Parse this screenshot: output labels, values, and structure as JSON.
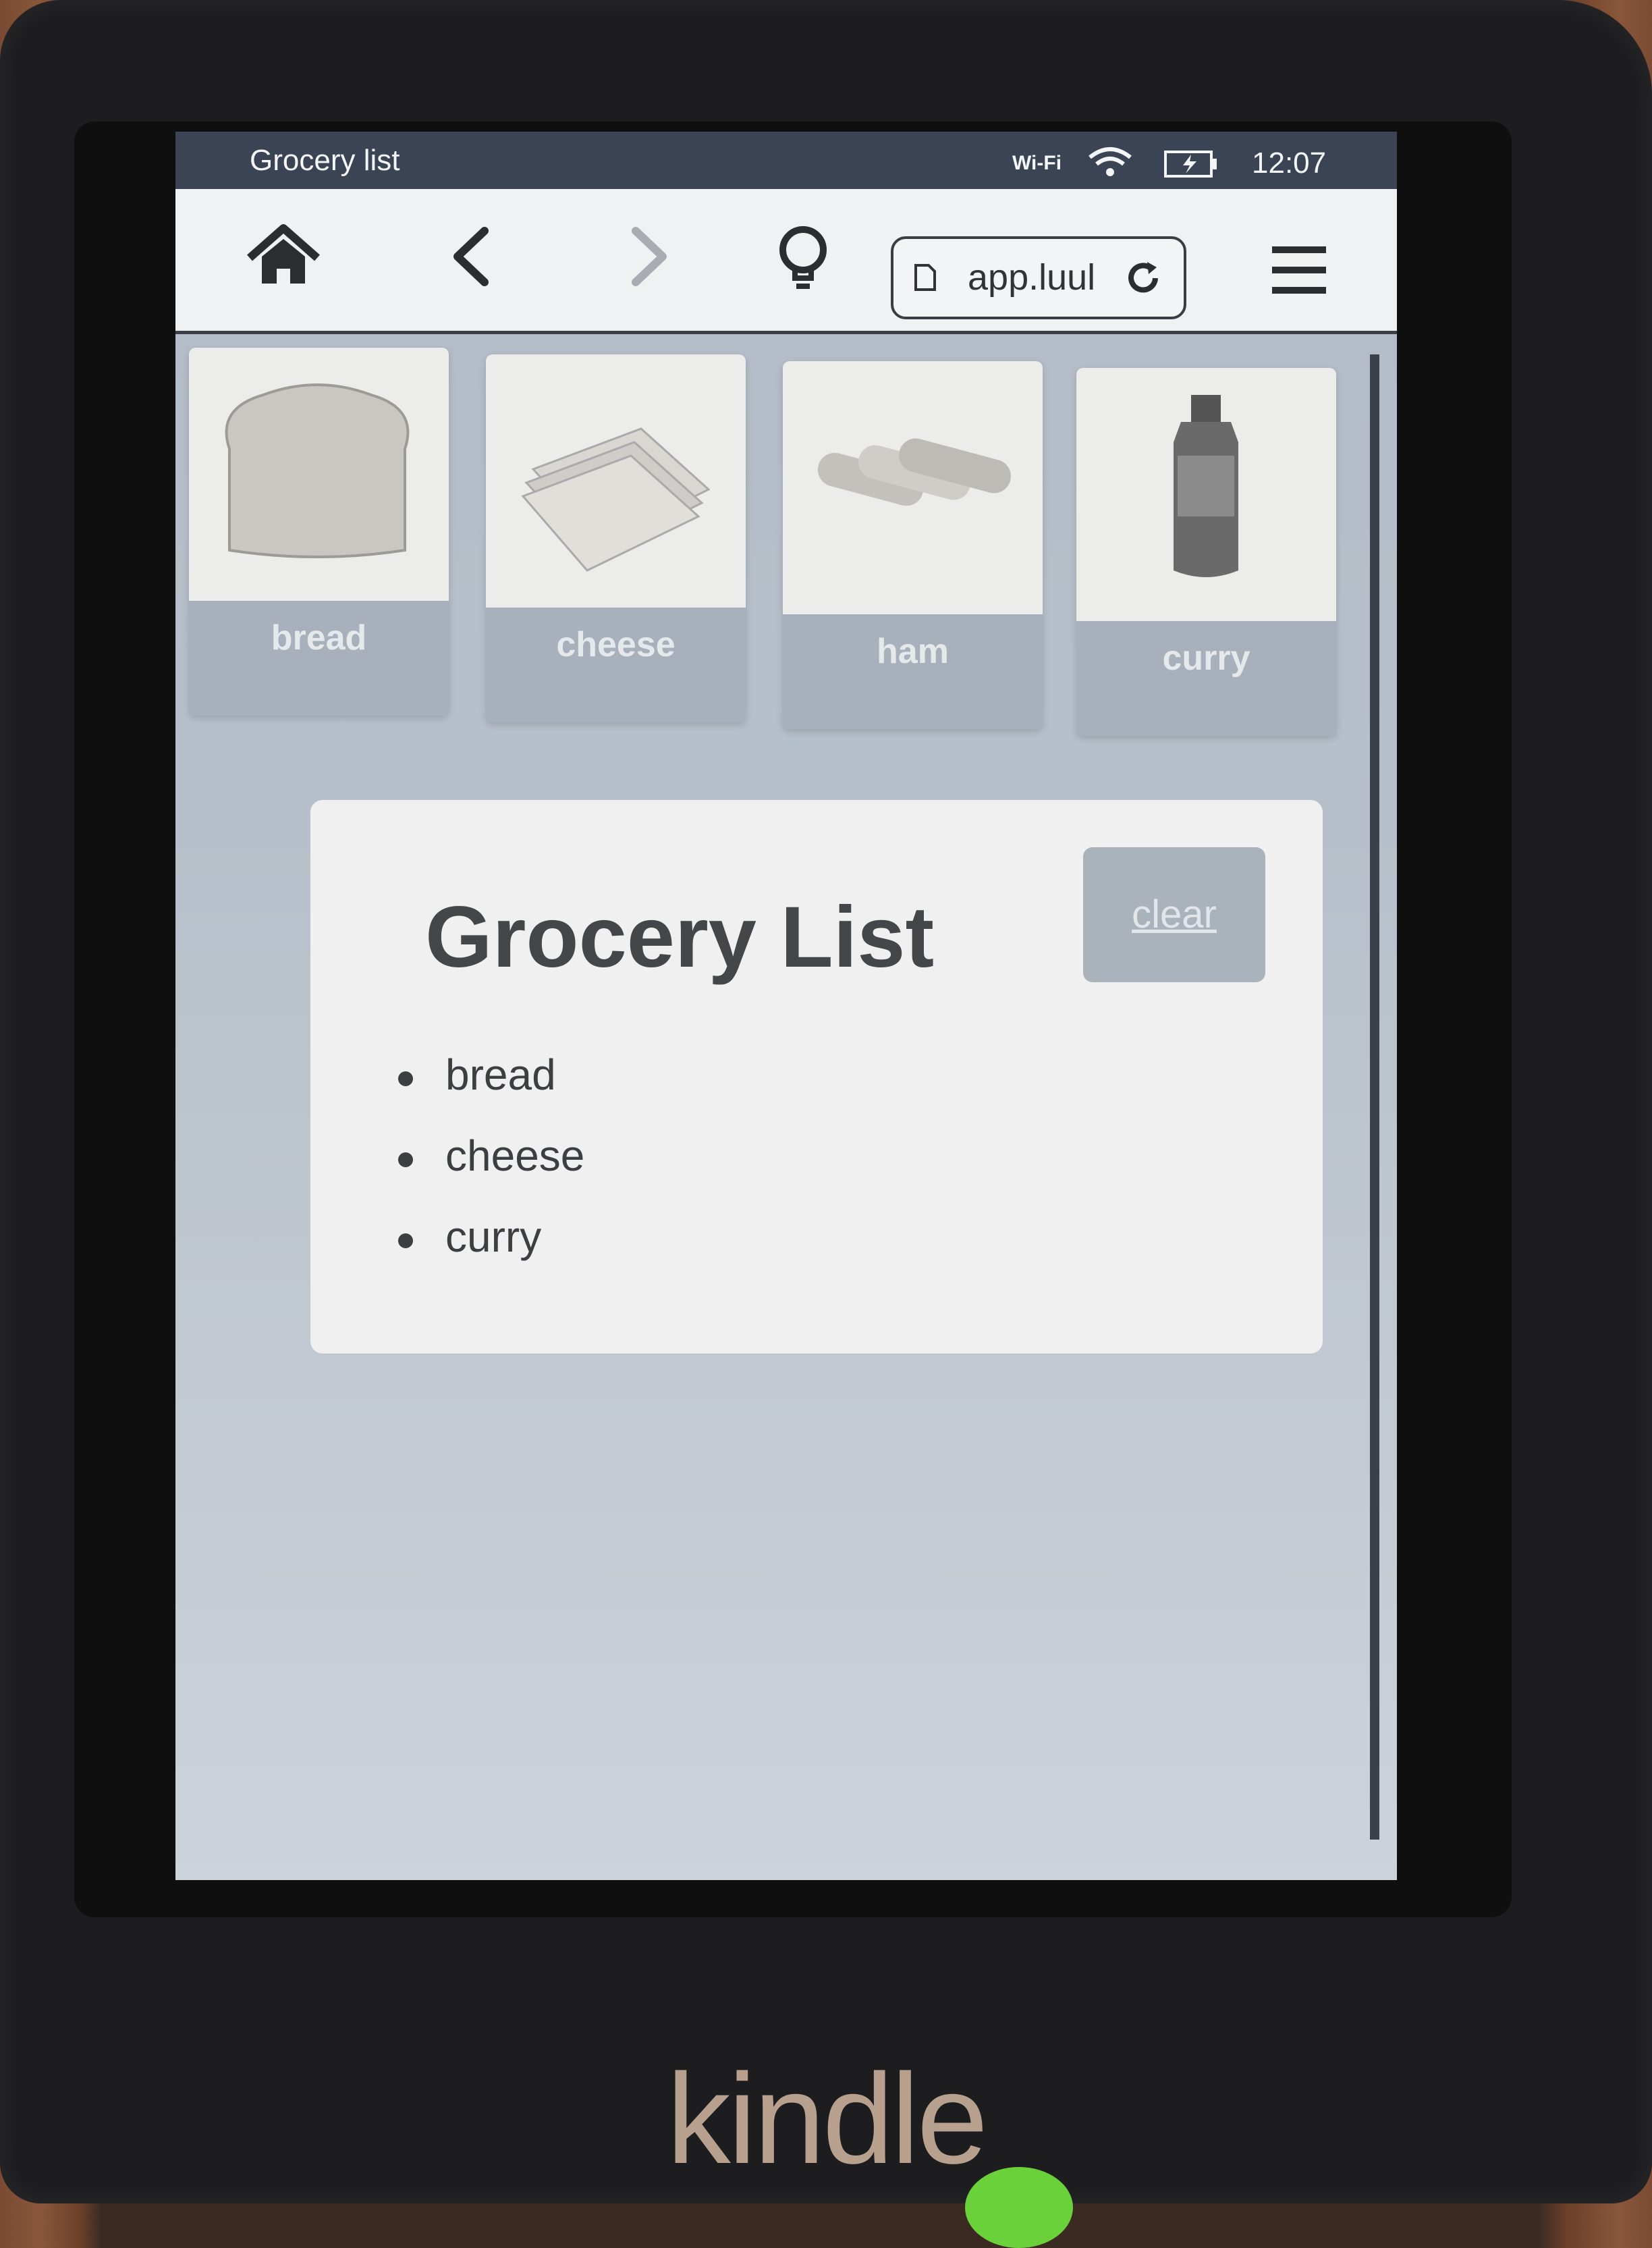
{
  "statusbar": {
    "title": "Grocery list",
    "wifi_label": "Wi-Fi",
    "clock": "12:07"
  },
  "toolbar": {
    "url": "app.luul",
    "icons": [
      "home-icon",
      "back-icon",
      "forward-icon",
      "lightbulb-icon",
      "document-icon",
      "reload-icon",
      "menu-icon"
    ]
  },
  "tiles": [
    {
      "label": "bread"
    },
    {
      "label": "cheese"
    },
    {
      "label": "ham"
    },
    {
      "label": "curry"
    }
  ],
  "card": {
    "heading": "Grocery List",
    "clear_label": "clear",
    "items": [
      "bread",
      "cheese",
      "curry"
    ]
  },
  "device": {
    "brand": "kindle"
  },
  "colors": {
    "statusbar_bg": "#3b4455",
    "screen_bg": "#b7c0ca",
    "card_bg": "#eff0ef",
    "tile_label_bg": "#a8b1bb",
    "led": "#6bd13a"
  }
}
